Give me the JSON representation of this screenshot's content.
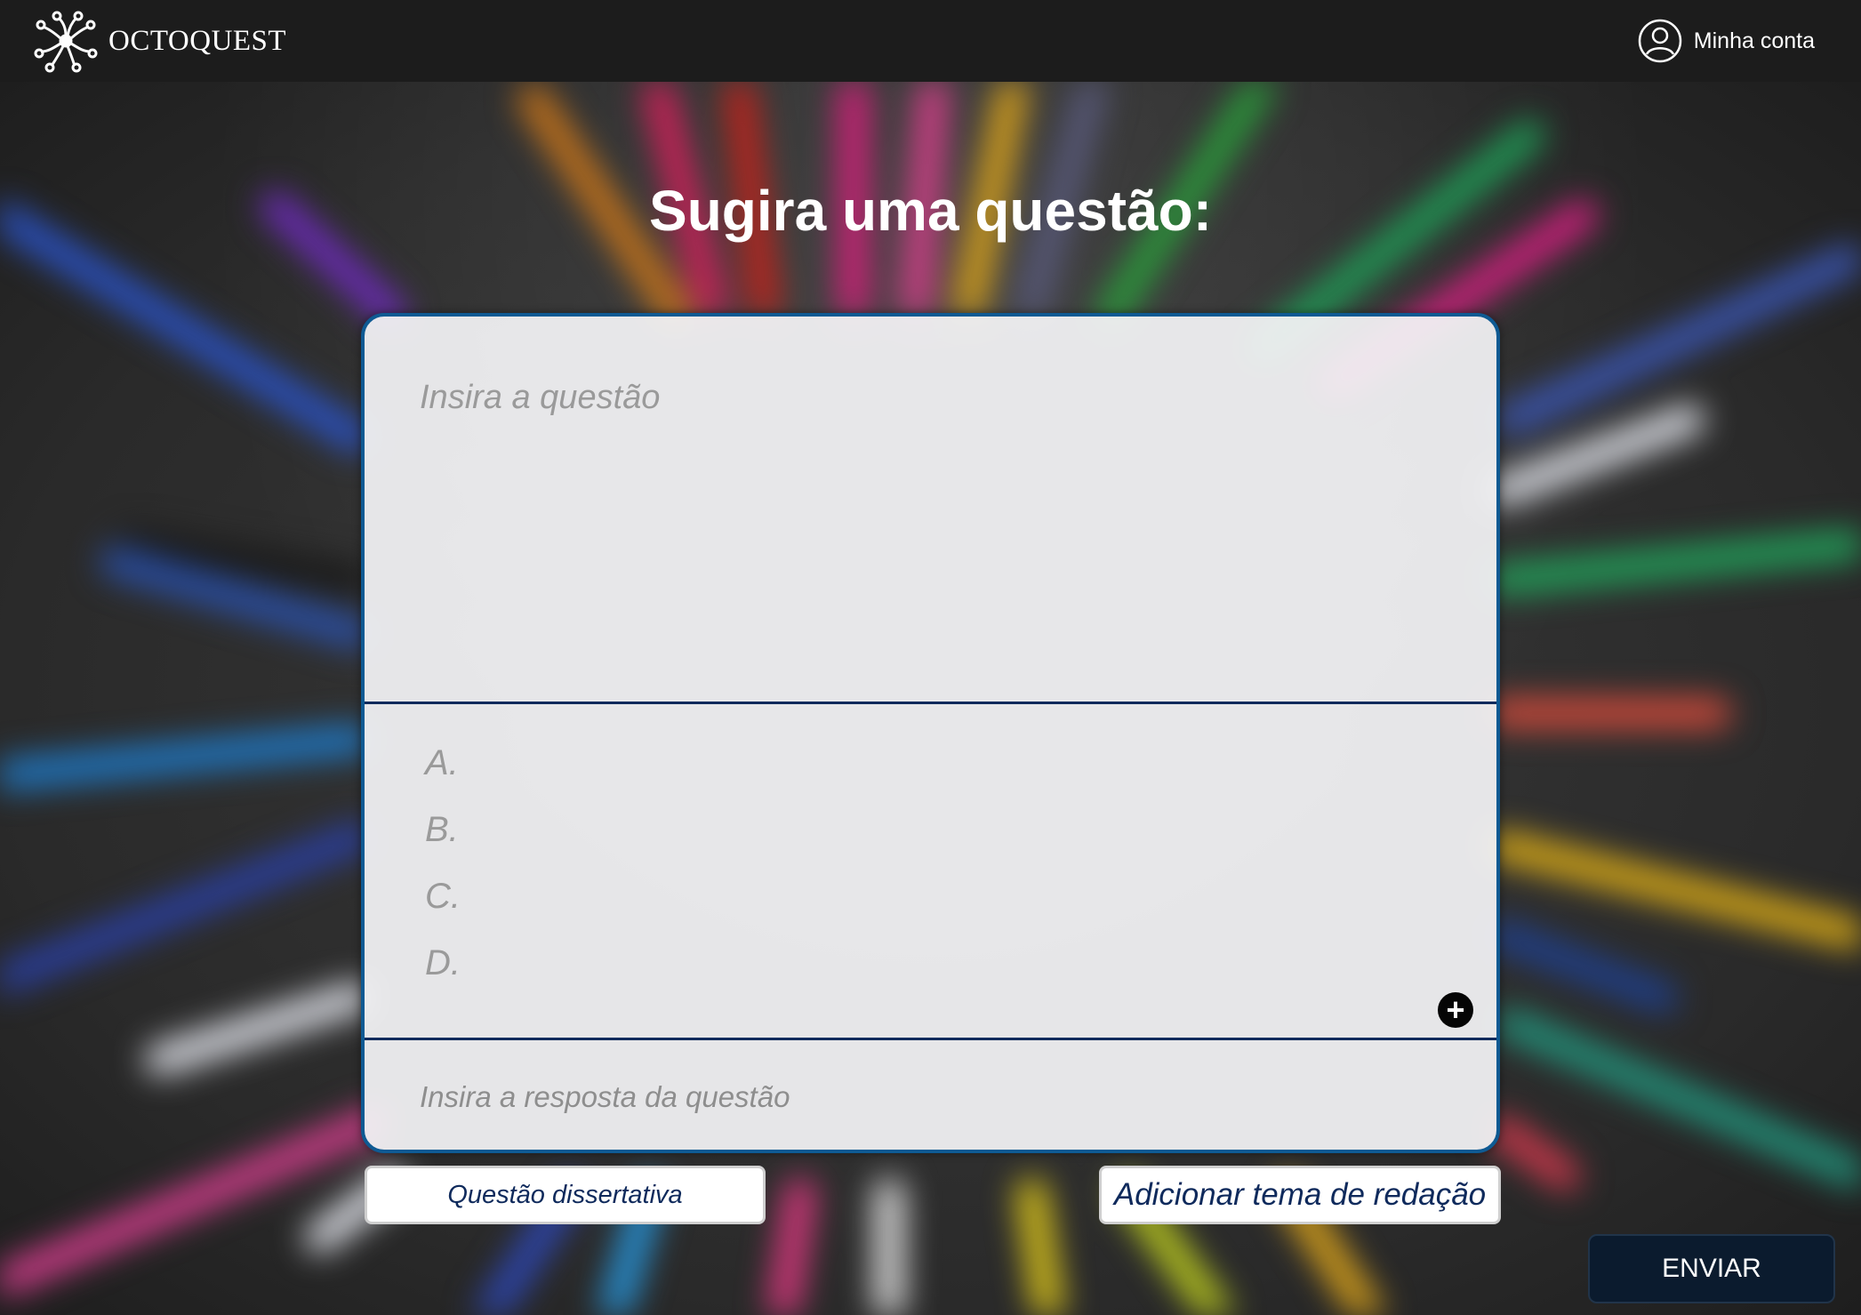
{
  "header": {
    "brand_name": "OCTOQUEST",
    "logo_icon": "octopus-logo-icon",
    "account_label": "Minha conta",
    "account_icon": "user-circle-icon"
  },
  "page": {
    "title": "Sugira uma questão:"
  },
  "form": {
    "question_placeholder": "Insira a questão",
    "options": [
      "A.",
      "B.",
      "C.",
      "D."
    ],
    "add_option_icon": "plus-circle-icon",
    "answer_placeholder": "Insira a resposta da questão"
  },
  "actions": {
    "dissertativa_label": "Questão dissertativa",
    "redacao_label": "Adicionar tema de redação",
    "send_label": "ENVIAR"
  },
  "colors": {
    "topbar": "#1c1c1c",
    "card_border": "#0e5a93",
    "divider": "#0f2a5c",
    "send_button": "#0b1b2e"
  }
}
